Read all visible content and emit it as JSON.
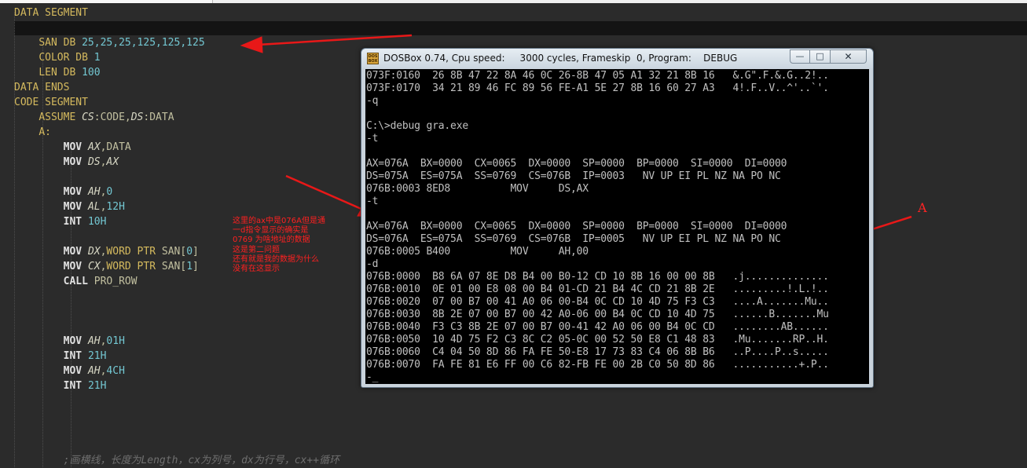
{
  "editor": {
    "lines": [
      [
        [
          "kw",
          "DATA SEGMENT"
        ]
      ],
      [],
      [
        [
          "op",
          "    "
        ],
        [
          "kw",
          "SAN DB "
        ],
        [
          "num",
          "25,25,25,125,125,125"
        ]
      ],
      [
        [
          "op",
          "    "
        ],
        [
          "kw",
          "COLOR DB "
        ],
        [
          "num",
          "1"
        ]
      ],
      [
        [
          "op",
          "    "
        ],
        [
          "kw",
          "LEN DB "
        ],
        [
          "num",
          "100"
        ]
      ],
      [
        [
          "kw",
          "DATA ENDS"
        ]
      ],
      [
        [
          "kw",
          "CODE SEGMENT"
        ]
      ],
      [
        [
          "op",
          "    "
        ],
        [
          "kw",
          "ASSUME "
        ],
        [
          "reg",
          "CS"
        ],
        [
          "op",
          ":CODE,"
        ],
        [
          "reg",
          "DS"
        ],
        [
          "op",
          ":DATA"
        ]
      ],
      [
        [
          "op",
          "    "
        ],
        [
          "kw",
          "A:"
        ]
      ],
      [
        [
          "op",
          "        "
        ],
        [
          "kwb",
          "MOV "
        ],
        [
          "reg",
          "AX"
        ],
        [
          "op",
          ",DATA"
        ]
      ],
      [
        [
          "op",
          "        "
        ],
        [
          "kwb",
          "MOV "
        ],
        [
          "reg",
          "DS"
        ],
        [
          "op",
          ","
        ],
        [
          "reg",
          "AX"
        ]
      ],
      [],
      [
        [
          "op",
          "        "
        ],
        [
          "kwb",
          "MOV "
        ],
        [
          "reg",
          "AH"
        ],
        [
          "op",
          ","
        ],
        [
          "num",
          "0"
        ]
      ],
      [
        [
          "op",
          "        "
        ],
        [
          "kwb",
          "MOV "
        ],
        [
          "reg",
          "AL"
        ],
        [
          "op",
          ","
        ],
        [
          "num",
          "12H"
        ]
      ],
      [
        [
          "op",
          "        "
        ],
        [
          "kwb",
          "INT "
        ],
        [
          "num",
          "10H"
        ]
      ],
      [],
      [
        [
          "op",
          "        "
        ],
        [
          "kwb",
          "MOV "
        ],
        [
          "reg",
          "DX"
        ],
        [
          "op",
          ","
        ],
        [
          "kw",
          "WORD PTR "
        ],
        [
          "op",
          "SAN["
        ],
        [
          "num",
          "0"
        ],
        [
          "op",
          "]"
        ]
      ],
      [
        [
          "op",
          "        "
        ],
        [
          "kwb",
          "MOV "
        ],
        [
          "reg",
          "CX"
        ],
        [
          "op",
          ","
        ],
        [
          "kw",
          "WORD PTR "
        ],
        [
          "op",
          "SAN["
        ],
        [
          "num",
          "1"
        ],
        [
          "op",
          "]"
        ]
      ],
      [
        [
          "op",
          "        "
        ],
        [
          "kwb",
          "CALL "
        ],
        [
          "op",
          "PRO_ROW"
        ]
      ],
      [],
      [],
      [],
      [
        [
          "op",
          "        "
        ],
        [
          "kwb",
          "MOV "
        ],
        [
          "reg",
          "AH"
        ],
        [
          "op",
          ","
        ],
        [
          "num",
          "01H"
        ]
      ],
      [
        [
          "op",
          "        "
        ],
        [
          "kwb",
          "INT "
        ],
        [
          "num",
          "21H"
        ]
      ],
      [
        [
          "op",
          "        "
        ],
        [
          "kwb",
          "MOV "
        ],
        [
          "reg",
          "AH"
        ],
        [
          "op",
          ","
        ],
        [
          "num",
          "4CH"
        ]
      ],
      [
        [
          "op",
          "        "
        ],
        [
          "kwb",
          "INT "
        ],
        [
          "num",
          "21H"
        ]
      ],
      [],
      [],
      [],
      [],
      [
        [
          "op",
          "        "
        ],
        [
          "cmt",
          ";画横线，长度为Length，cx为列号，dx为行号，cx++循环"
        ]
      ]
    ]
  },
  "annotation": {
    "note_lines": [
      "这里的ax中是076A但是通",
      "一d指令显示的确实是",
      "0769 为啥地址的数据",
      "这是第二问题",
      "还有就是我的数据为什么",
      "没有在这显示"
    ],
    "label": "A",
    "arrow_color": "#e81818"
  },
  "dosbox": {
    "title": "DOSBox 0.74, Cpu speed:     3000 cycles, Frameskip  0, Program:    DEBUG",
    "icon_text": "DOS BOX",
    "buttons": {
      "minimize": "—",
      "maximize": "□",
      "close": "✕"
    },
    "lines": [
      "073F:0160  26 8B 47 22 8A 46 0C 26-8B 47 05 A1 32 21 8B 16   &.G\".F.&.G..2!..",
      "073F:0170  34 21 89 46 FC 89 56 FE-A1 5E 27 8B 16 60 27 A3   4!.F..V..^'..`'.",
      "-q",
      "",
      "C:\\>debug gra.exe",
      "-t",
      "",
      "AX=076A  BX=0000  CX=0065  DX=0000  SP=0000  BP=0000  SI=0000  DI=0000",
      "DS=075A  ES=075A  SS=0769  CS=076B  IP=0003   NV UP EI PL NZ NA PO NC",
      "076B:0003 8ED8          MOV     DS,AX",
      "-t",
      "",
      "AX=076A  BX=0000  CX=0065  DX=0000  SP=0000  BP=0000  SI=0000  DI=0000",
      "DS=076A  ES=075A  SS=0769  CS=076B  IP=0005   NV UP EI PL NZ NA PO NC",
      "076B:0005 B400          MOV     AH,00",
      "-d",
      "076B:0000  B8 6A 07 8E D8 B4 00 B0-12 CD 10 8B 16 00 00 8B   .j..............",
      "076B:0010  0E 01 00 E8 08 00 B4 01-CD 21 B4 4C CD 21 8B 2E   .........!.L.!..",
      "076B:0020  07 00 B7 00 41 A0 06 00-B4 0C CD 10 4D 75 F3 C3   ....A.......Mu..",
      "076B:0030  8B 2E 07 00 B7 00 42 A0-06 00 B4 0C CD 10 4D 75   ......B.......Mu",
      "076B:0040  F3 C3 8B 2E 07 00 B7 00-41 42 A0 06 00 B4 0C CD   ........AB......",
      "076B:0050  10 4D 75 F2 C3 8C C2 05-0C 00 52 50 E8 C1 48 83   .Mu.......RP..H.",
      "076B:0060  C4 04 50 8D 86 FA FE 50-E8 17 73 83 C4 06 8B B6   ..P....P..s.....",
      "076B:0070  FA FE 81 E6 FF 00 C6 82-FB FE 00 2B C0 50 8D 86   ...........+.P..",
      "-_"
    ]
  }
}
